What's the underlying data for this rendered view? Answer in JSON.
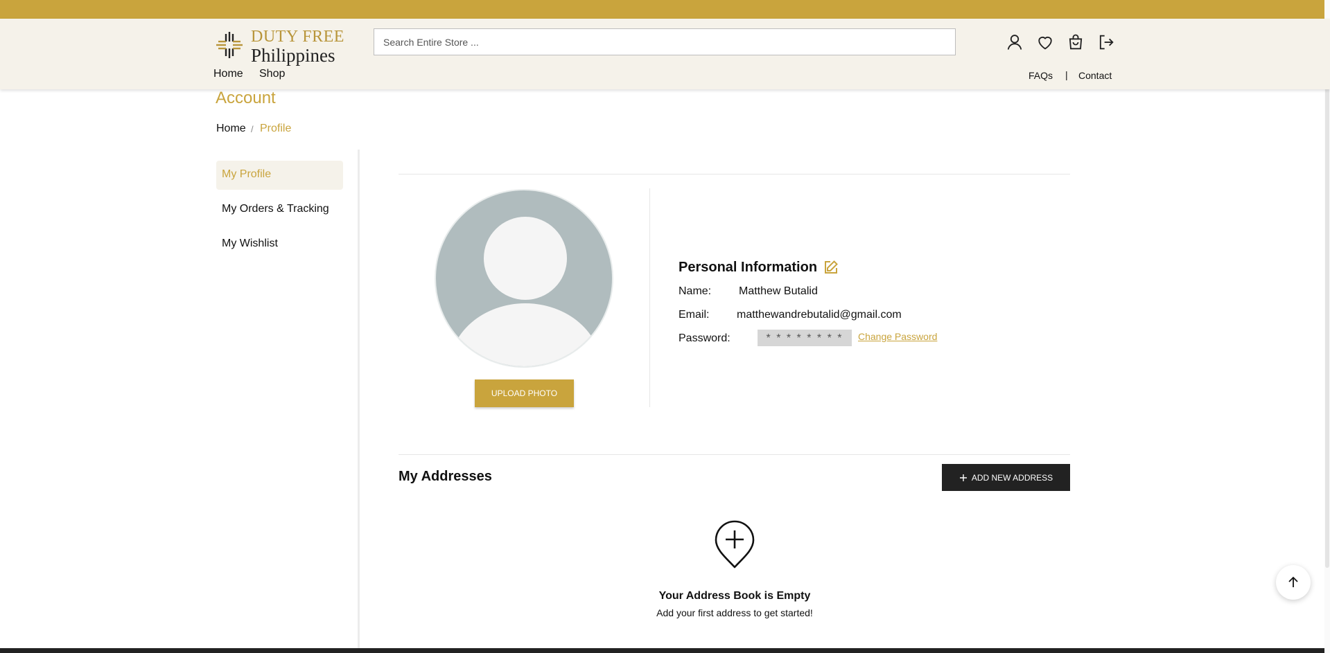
{
  "header": {
    "logo": {
      "line1": "DUTY FREE",
      "line2": "Philippines"
    },
    "search_placeholder": "Search Entire Store ...",
    "nav": {
      "home": "Home",
      "shop": "Shop",
      "faqs": "FAQs",
      "separator": "|",
      "contact": "Contact"
    },
    "icons": [
      "user-icon",
      "heart-icon",
      "bag-icon",
      "logout-icon"
    ]
  },
  "page": {
    "title": "Account",
    "breadcrumb": {
      "home": "Home",
      "separator": "/",
      "current": "Profile"
    }
  },
  "sidebar": {
    "items": [
      {
        "label": "My Profile",
        "active": true
      },
      {
        "label": "My Orders & Tracking",
        "active": false
      },
      {
        "label": "My Wishlist",
        "active": false
      }
    ]
  },
  "profile": {
    "upload_label": "UPLOAD PHOTO",
    "section_title": "Personal Information",
    "name_label": "Name:",
    "name_value": "Matthew Butalid",
    "email_label": "Email:",
    "email_value": "matthewandrebutalid@gmail.com",
    "password_label": "Password:",
    "password_mask": "* * * * * * * *",
    "change_password": "Change Password"
  },
  "addresses": {
    "title": "My Addresses",
    "add_label": "ADD NEW ADDRESS",
    "empty_title": "Your Address Book is Empty",
    "empty_subtitle": "Add your first address to get started!"
  },
  "colors": {
    "brand": "#c9a43d",
    "header_bg": "#f5f2ea",
    "dark": "#222222"
  }
}
